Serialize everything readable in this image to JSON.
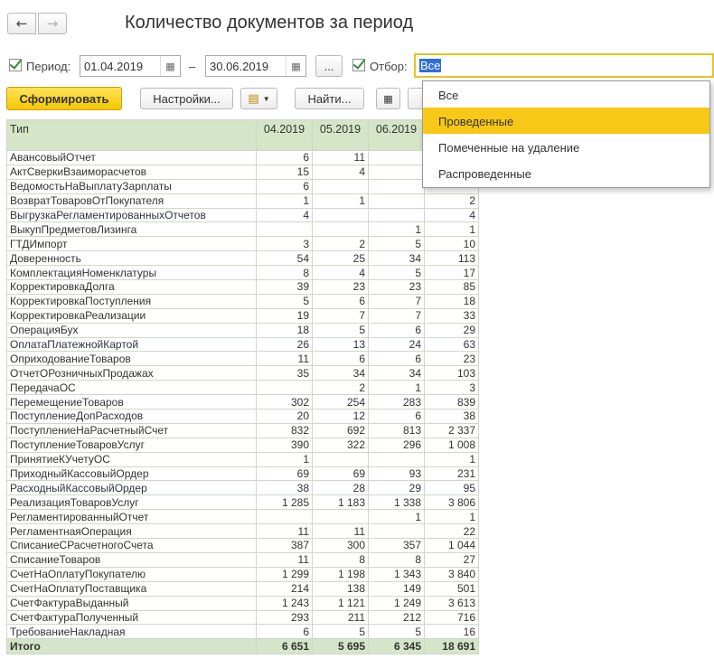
{
  "nav": {
    "back_icon": "arrow-left-icon",
    "forward_icon": "arrow-right-icon"
  },
  "title": "Количество документов за период",
  "period": {
    "label": "Период:",
    "from": "01.04.2019",
    "dash": "–",
    "to": "30.06.2019",
    "more": "..."
  },
  "filter": {
    "label": "Отбор:",
    "value": "Все",
    "options": [
      "Все",
      "Проведенные",
      "Помеченные на удаление",
      "Распроведенные"
    ],
    "highlighted_index": 1
  },
  "toolbar": {
    "generate": "Сформировать",
    "settings": "Настройки...",
    "find": "Найти..."
  },
  "table": {
    "headers": [
      "Тип",
      "04.2019",
      "05.2019",
      "06.2019",
      ""
    ],
    "rows": [
      [
        "АвансовыйОтчет",
        "6",
        "11",
        "",
        ""
      ],
      [
        "АктСверкиВзаиморасчетов",
        "15",
        "4",
        "",
        ""
      ],
      [
        "ВедомостьНаВыплатуЗарплаты",
        "6",
        "",
        "",
        ""
      ],
      [
        "ВозвратТоваровОтПокупателя",
        "1",
        "1",
        "",
        "2"
      ],
      [
        "ВыгрузкаРегламентированныхОтчетов",
        "4",
        "",
        "",
        "4"
      ],
      [
        "ВыкупПредметовЛизинга",
        "",
        "",
        "1",
        "1"
      ],
      [
        "ГТДИмпорт",
        "3",
        "2",
        "5",
        "10"
      ],
      [
        "Доверенность",
        "54",
        "25",
        "34",
        "113"
      ],
      [
        "КомплектацияНоменклатуры",
        "8",
        "4",
        "5",
        "17"
      ],
      [
        "КорректировкаДолга",
        "39",
        "23",
        "23",
        "85"
      ],
      [
        "КорректировкаПоступления",
        "5",
        "6",
        "7",
        "18"
      ],
      [
        "КорректировкаРеализации",
        "19",
        "7",
        "7",
        "33"
      ],
      [
        "ОперацияБух",
        "18",
        "5",
        "6",
        "29"
      ],
      [
        "ОплатаПлатежнойКартой",
        "26",
        "13",
        "24",
        "63"
      ],
      [
        "ОприходованиеТоваров",
        "11",
        "6",
        "6",
        "23"
      ],
      [
        "ОтчетОРозничныхПродажах",
        "35",
        "34",
        "34",
        "103"
      ],
      [
        "ПередачаОС",
        "",
        "2",
        "1",
        "3"
      ],
      [
        "ПеремещениеТоваров",
        "302",
        "254",
        "283",
        "839"
      ],
      [
        "ПоступлениеДопРасходов",
        "20",
        "12",
        "6",
        "38"
      ],
      [
        "ПоступлениеНаРасчетныйСчет",
        "832",
        "692",
        "813",
        "2 337"
      ],
      [
        "ПоступлениеТоваровУслуг",
        "390",
        "322",
        "296",
        "1 008"
      ],
      [
        "ПринятиеКУчетуОС",
        "1",
        "",
        "",
        "1"
      ],
      [
        "ПриходныйКассовыйОрдер",
        "69",
        "69",
        "93",
        "231"
      ],
      [
        "РасходныйКассовыйОрдер",
        "38",
        "28",
        "29",
        "95"
      ],
      [
        "РеализацияТоваровУслуг",
        "1 285",
        "1 183",
        "1 338",
        "3 806"
      ],
      [
        "РегламентированныйОтчет",
        "",
        "",
        "1",
        "1"
      ],
      [
        "РегламентнаяОперация",
        "11",
        "11",
        "",
        "22"
      ],
      [
        "СписаниеСРасчетногоСчета",
        "387",
        "300",
        "357",
        "1 044"
      ],
      [
        "СписаниеТоваров",
        "11",
        "8",
        "8",
        "27"
      ],
      [
        "СчетНаОплатуПокупателю",
        "1 299",
        "1 198",
        "1 343",
        "3 840"
      ],
      [
        "СчетНаОплатуПоставщика",
        "214",
        "138",
        "149",
        "501"
      ],
      [
        "СчетФактураВыданный",
        "1 243",
        "1 121",
        "1 249",
        "3 613"
      ],
      [
        "СчетФактураПолученный",
        "293",
        "211",
        "212",
        "716"
      ],
      [
        "ТребованиеНакладная",
        "6",
        "5",
        "5",
        "16"
      ]
    ],
    "total": [
      "Итого",
      "6 651",
      "5 695",
      "6 345",
      "18 691"
    ]
  },
  "colors": {
    "accent_yellow": "#f5c800",
    "table_header_green": "#d5e5c8",
    "selection_blue": "#2f6fd6"
  }
}
